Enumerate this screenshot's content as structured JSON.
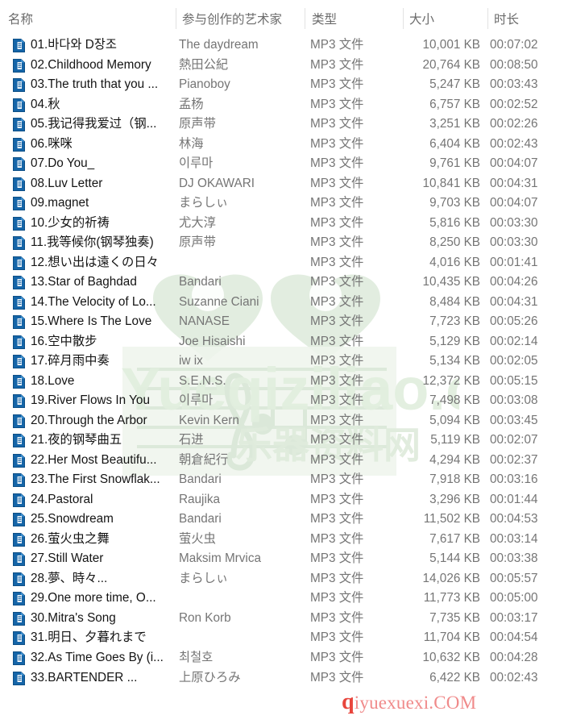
{
  "window": {
    "view": "details"
  },
  "columns": {
    "name": "名称",
    "artist": "参与创作的艺术家",
    "type": "类型",
    "size": "大小",
    "duration": "时长"
  },
  "watermarks": {
    "green_text": "Yueqiziliao.com",
    "green_cn": "乐器资料网",
    "red_lead": "q",
    "red_text": "iyuexuexi.COM"
  },
  "files": [
    {
      "name": "01.바다와 D장조",
      "artist": "The daydream",
      "type": "MP3 文件",
      "size": "10,001 KB",
      "duration": "00:07:02"
    },
    {
      "name": "02.Childhood Memory",
      "artist": "熱田公紀",
      "type": "MP3 文件",
      "size": "20,764 KB",
      "duration": "00:08:50"
    },
    {
      "name": "03.The truth that you ...",
      "artist": "Pianoboy",
      "type": "MP3 文件",
      "size": "5,247 KB",
      "duration": "00:03:43"
    },
    {
      "name": "04.秋",
      "artist": "孟杨",
      "type": "MP3 文件",
      "size": "6,757 KB",
      "duration": "00:02:52"
    },
    {
      "name": "05.我记得我爱过（钢...",
      "artist": "原声带",
      "type": "MP3 文件",
      "size": "3,251 KB",
      "duration": "00:02:26"
    },
    {
      "name": "06.咪咪",
      "artist": "林海",
      "type": "MP3 文件",
      "size": "6,404 KB",
      "duration": "00:02:43"
    },
    {
      "name": "07.Do You_",
      "artist": "이루마",
      "type": "MP3 文件",
      "size": "9,761 KB",
      "duration": "00:04:07"
    },
    {
      "name": "08.Luv Letter",
      "artist": "DJ OKAWARI",
      "type": "MP3 文件",
      "size": "10,841 KB",
      "duration": "00:04:31"
    },
    {
      "name": "09.magnet",
      "artist": "まらしぃ",
      "type": "MP3 文件",
      "size": "9,703 KB",
      "duration": "00:04:07"
    },
    {
      "name": "10.少女的祈祷",
      "artist": "尤大淳",
      "type": "MP3 文件",
      "size": "5,816 KB",
      "duration": "00:03:30"
    },
    {
      "name": "11.我等候你(钢琴独奏)",
      "artist": "原声带",
      "type": "MP3 文件",
      "size": "8,250 KB",
      "duration": "00:03:30"
    },
    {
      "name": "12.想い出は遠くの日々",
      "artist": "",
      "type": "MP3 文件",
      "size": "4,016 KB",
      "duration": "00:01:41"
    },
    {
      "name": "13.Star of Baghdad",
      "artist": "Bandari",
      "type": "MP3 文件",
      "size": "10,435 KB",
      "duration": "00:04:26"
    },
    {
      "name": "14.The Velocity of Lo...",
      "artist": "Suzanne Ciani",
      "type": "MP3 文件",
      "size": "8,484 KB",
      "duration": "00:04:31"
    },
    {
      "name": "15.Where Is The Love",
      "artist": "NANASE",
      "type": "MP3 文件",
      "size": "7,723 KB",
      "duration": "00:05:26"
    },
    {
      "name": "16.空中散步",
      "artist": "Joe Hisaishi",
      "type": "MP3 文件",
      "size": "5,129 KB",
      "duration": "00:02:14"
    },
    {
      "name": "17.碎月雨中奏",
      "artist": "iw ix",
      "type": "MP3 文件",
      "size": "5,134 KB",
      "duration": "00:02:05"
    },
    {
      "name": "18.Love",
      "artist": "S.E.N.S.",
      "type": "MP3 文件",
      "size": "12,372 KB",
      "duration": "00:05:15"
    },
    {
      "name": "19.River Flows In You",
      "artist": "이루마",
      "type": "MP3 文件",
      "size": "7,498 KB",
      "duration": "00:03:08"
    },
    {
      "name": "20.Through the Arbor",
      "artist": "Kevin Kern",
      "type": "MP3 文件",
      "size": "5,094 KB",
      "duration": "00:03:45"
    },
    {
      "name": "21.夜的钢琴曲五",
      "artist": "石进",
      "type": "MP3 文件",
      "size": "5,119 KB",
      "duration": "00:02:07"
    },
    {
      "name": "22.Her Most Beautifu...",
      "artist": "朝倉紀行",
      "type": "MP3 文件",
      "size": "4,294 KB",
      "duration": "00:02:37"
    },
    {
      "name": "23.The First Snowflak...",
      "artist": "Bandari",
      "type": "MP3 文件",
      "size": "7,918 KB",
      "duration": "00:03:16"
    },
    {
      "name": "24.Pastoral",
      "artist": "Raujika",
      "type": "MP3 文件",
      "size": "3,296 KB",
      "duration": "00:01:44"
    },
    {
      "name": "25.Snowdream",
      "artist": "Bandari",
      "type": "MP3 文件",
      "size": "11,502 KB",
      "duration": "00:04:53"
    },
    {
      "name": "26.萤火虫之舞",
      "artist": "萤火虫",
      "type": "MP3 文件",
      "size": "7,617 KB",
      "duration": "00:03:14"
    },
    {
      "name": "27.Still Water",
      "artist": "Maksim Mrvica",
      "type": "MP3 文件",
      "size": "5,144 KB",
      "duration": "00:03:38"
    },
    {
      "name": "28.夢、時々...",
      "artist": "まらしぃ",
      "type": "MP3 文件",
      "size": "14,026 KB",
      "duration": "00:05:57"
    },
    {
      "name": "29.One more time, O...",
      "artist": "",
      "type": "MP3 文件",
      "size": "11,773 KB",
      "duration": "00:05:00"
    },
    {
      "name": "30.Mitra's Song",
      "artist": "Ron Korb",
      "type": "MP3 文件",
      "size": "7,735 KB",
      "duration": "00:03:17"
    },
    {
      "name": "31.明日、夕暮れまで",
      "artist": "",
      "type": "MP3 文件",
      "size": "11,704 KB",
      "duration": "00:04:54"
    },
    {
      "name": "32.As Time Goes By (i...",
      "artist": "최철호",
      "type": "MP3 文件",
      "size": "10,632 KB",
      "duration": "00:04:28"
    },
    {
      "name": "33.BARTENDER ...",
      "artist": "上原ひろみ",
      "type": "MP3 文件",
      "size": "6,422 KB",
      "duration": "00:02:43"
    }
  ]
}
